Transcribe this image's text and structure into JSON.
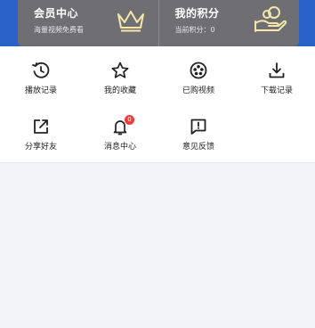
{
  "promo": {
    "member": {
      "title": "会员中心",
      "subtitle": "海量视频免费看",
      "icon": "crown-icon"
    },
    "points": {
      "title": "我的积分",
      "subtitle": "当前积分：0",
      "icon": "hand-coin-icon"
    }
  },
  "menu": {
    "items": [
      {
        "label": "播放记录",
        "icon": "history-icon"
      },
      {
        "label": "我的收藏",
        "icon": "star-icon"
      },
      {
        "label": "已购视频",
        "icon": "film-reel-icon"
      },
      {
        "label": "下载记录",
        "icon": "download-icon"
      },
      {
        "label": "分享好友",
        "icon": "share-icon"
      },
      {
        "label": "消息中心",
        "icon": "bell-icon",
        "badge": "0"
      },
      {
        "label": "意见反馈",
        "icon": "feedback-icon"
      }
    ]
  },
  "colors": {
    "brand_blue": "#2a62c9",
    "promo_card": "#6f6f73",
    "accent_gold": "#f5e6a8",
    "badge_red": "#ef3b3b"
  }
}
